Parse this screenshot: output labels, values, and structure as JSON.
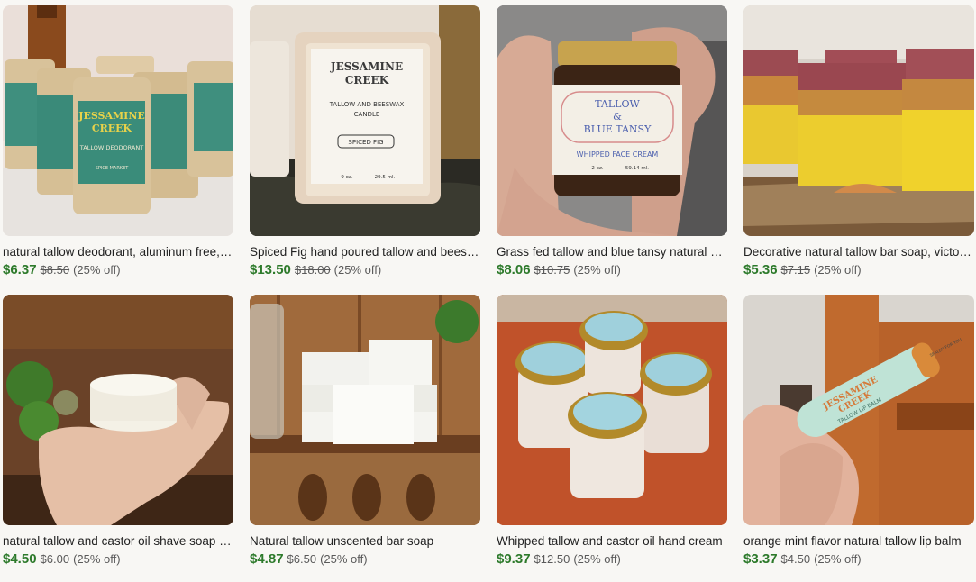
{
  "listings": [
    {
      "title": "natural tallow deodorant, aluminum free, baking soda free",
      "price": "$6.37",
      "original_price": "$8.50",
      "discount": "(25% off)",
      "image": "deodorant-tubes",
      "label_text": [
        "JESSAMINE",
        "CREEK",
        "TALLOW DEODORANT",
        "SPICE MARKET"
      ]
    },
    {
      "title": "Spiced Fig hand poured tallow and beeswax candle",
      "price": "$13.50",
      "original_price": "$18.00",
      "discount": "(25% off)",
      "image": "candle",
      "label_text": [
        "JESSAMINE",
        "CREEK",
        "TALLOW AND BEESWAX",
        "CANDLE",
        "SPICED FIG",
        "9 oz.",
        "29.5 ml."
      ]
    },
    {
      "title": "Grass fed tallow and blue tansy natural whipped face cream",
      "price": "$8.06",
      "original_price": "$10.75",
      "discount": "(25% off)",
      "image": "face-cream-jar",
      "label_text": [
        "TALLOW",
        "&",
        "BLUE TANSY",
        "WHIPPED FACE CREAM",
        "2 oz.",
        "59.14 ml."
      ]
    },
    {
      "title": "Decorative natural tallow bar soap, victorian style",
      "price": "$5.36",
      "original_price": "$7.15",
      "discount": "(25% off)",
      "image": "bar-soap-layers"
    },
    {
      "title": "natural tallow and castor oil shave soap puck",
      "price": "$4.50",
      "original_price": "$6.00",
      "discount": "(25% off)",
      "image": "shave-soap"
    },
    {
      "title": "Natural tallow unscented bar soap",
      "price": "$4.87",
      "original_price": "$6.50",
      "discount": "(25% off)",
      "image": "unscented-soap"
    },
    {
      "title": "Whipped tallow and castor oil hand cream",
      "price": "$9.37",
      "original_price": "$12.50",
      "discount": "(25% off)",
      "image": "hand-cream-jars"
    },
    {
      "title": "orange mint flavor natural tallow lip balm",
      "price": "$3.37",
      "original_price": "$4.50",
      "discount": "(25% off)",
      "image": "lip-balm",
      "label_text": [
        "JESSAMINE",
        "CREEK",
        "TALLOW LIP BALM",
        "SEALED FOR YOU"
      ]
    }
  ],
  "colors": {
    "price": "#2d7a2b",
    "strike": "#595959",
    "background": "#f8f7f4"
  }
}
